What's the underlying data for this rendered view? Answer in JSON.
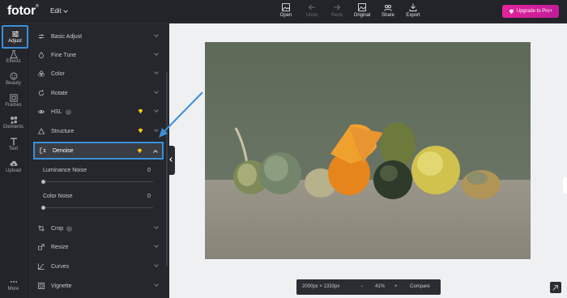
{
  "app": {
    "logo": "fotor",
    "logo_mark": "®",
    "edit_menu": "Edit"
  },
  "toolbar": {
    "open": "Open",
    "undo": "Undo",
    "redo": "Redo",
    "original": "Original",
    "share": "Share",
    "export": "Export"
  },
  "upgrade": {
    "label": "Upgrade to Pro+"
  },
  "rail": {
    "adjust": "Adjust",
    "effects": "Effects",
    "beauty": "Beauty",
    "frames": "Frames",
    "elements": "Elements",
    "text": "Text",
    "upload": "Upload",
    "more": "More"
  },
  "panel": {
    "basic_adjust": "Basic Adjust",
    "fine_tune": "Fine Tune",
    "color": "Color",
    "rotate": "Rotate",
    "hsl": "HSL",
    "structure": "Structure",
    "denoise": "Denoise",
    "luminance_noise": {
      "label": "Luminance Noise",
      "value": "0"
    },
    "color_noise": {
      "label": "Color Noise",
      "value": "0"
    },
    "crop": "Crop",
    "resize": "Resize",
    "curves": "Curves",
    "vignette": "Vignette"
  },
  "statusbar": {
    "dimensions": "2000px × 1333px",
    "zoom_out": "−",
    "zoom": "41%",
    "zoom_in": "+",
    "compare": "Compare"
  },
  "colors": {
    "accent": "#3a8fd8",
    "brand_pink": "#e5239a",
    "premium_gold": "#f0c419"
  }
}
